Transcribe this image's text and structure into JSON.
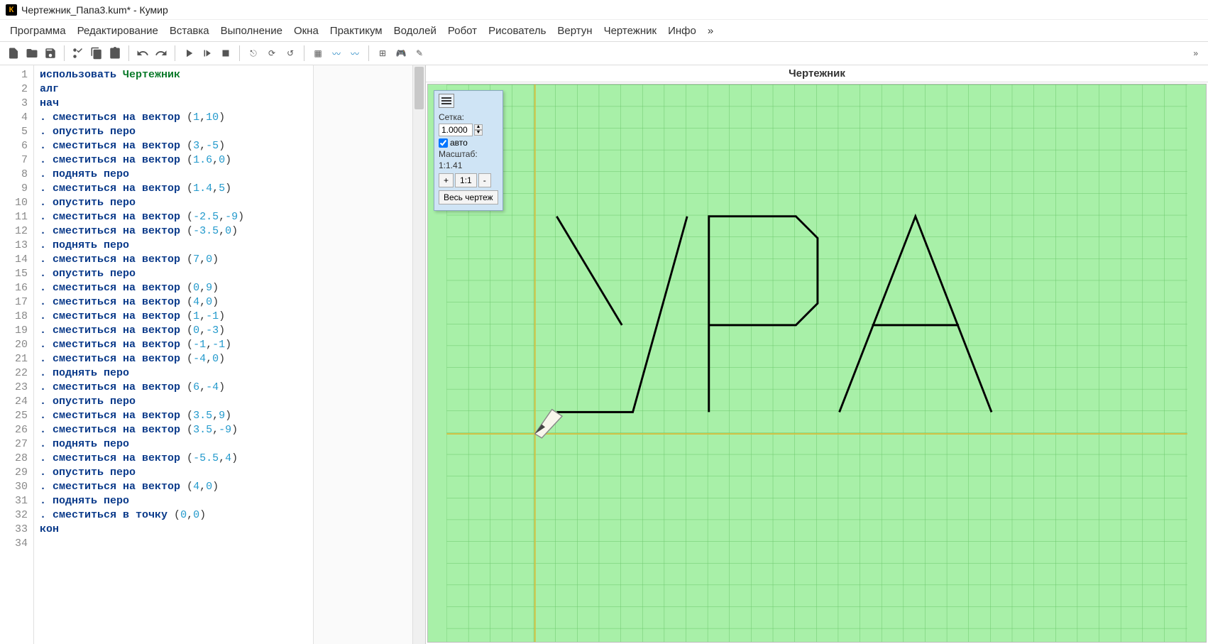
{
  "title": "Чертежник_Папа3.kum* - Кумир",
  "menu": [
    "Программа",
    "Редактирование",
    "Вставка",
    "Выполнение",
    "Окна",
    "Практикум",
    "Водолей",
    "Робот",
    "Рисователь",
    "Вертун",
    "Чертежник",
    "Инфо",
    "»"
  ],
  "panel_title": "Чертежник",
  "panel": {
    "grid_label": "Сетка:",
    "grid_value": "1.0000",
    "auto_label": "авто",
    "auto_checked": true,
    "scale_label": "Масштаб:",
    "scale_value": "1:1.41",
    "zoom_in": "+",
    "zoom_11": "1:1",
    "zoom_out": "-",
    "whole": "Весь чертеж"
  },
  "code": [
    {
      "n": 1,
      "t": "kw-use",
      "tokens": [
        {
          "c": "kw",
          "v": "использовать "
        },
        {
          "c": "kw2",
          "v": "Чертежник"
        }
      ]
    },
    {
      "n": 2,
      "tokens": [
        {
          "c": "kw",
          "v": "алг"
        }
      ]
    },
    {
      "n": 3,
      "tokens": [
        {
          "c": "kw",
          "v": "нач"
        }
      ]
    },
    {
      "n": 4,
      "tokens": [
        {
          "c": "dot",
          "v": ". "
        },
        {
          "c": "cmd",
          "v": "сместиться на вектор "
        },
        {
          "c": "paren",
          "v": "("
        },
        {
          "c": "num",
          "v": "1"
        },
        {
          "c": "paren",
          "v": ","
        },
        {
          "c": "num",
          "v": "10"
        },
        {
          "c": "paren",
          "v": ")"
        }
      ]
    },
    {
      "n": 5,
      "tokens": [
        {
          "c": "dot",
          "v": ". "
        },
        {
          "c": "cmd",
          "v": "опустить перо"
        }
      ]
    },
    {
      "n": 6,
      "tokens": [
        {
          "c": "dot",
          "v": ". "
        },
        {
          "c": "cmd",
          "v": "сместиться на вектор "
        },
        {
          "c": "paren",
          "v": "("
        },
        {
          "c": "num",
          "v": "3"
        },
        {
          "c": "paren",
          "v": ","
        },
        {
          "c": "num",
          "v": "-5"
        },
        {
          "c": "paren",
          "v": ")"
        }
      ]
    },
    {
      "n": 7,
      "tokens": [
        {
          "c": "dot",
          "v": ". "
        },
        {
          "c": "cmd",
          "v": "сместиться на вектор "
        },
        {
          "c": "paren",
          "v": "("
        },
        {
          "c": "num",
          "v": "1.6"
        },
        {
          "c": "paren",
          "v": ","
        },
        {
          "c": "num",
          "v": "0"
        },
        {
          "c": "paren",
          "v": ")"
        }
      ]
    },
    {
      "n": 8,
      "tokens": [
        {
          "c": "dot",
          "v": ". "
        },
        {
          "c": "cmd",
          "v": "поднять перо"
        }
      ]
    },
    {
      "n": 9,
      "tokens": [
        {
          "c": "dot",
          "v": ". "
        },
        {
          "c": "cmd",
          "v": "сместиться на вектор "
        },
        {
          "c": "paren",
          "v": "("
        },
        {
          "c": "num",
          "v": "1.4"
        },
        {
          "c": "paren",
          "v": ","
        },
        {
          "c": "num",
          "v": "5"
        },
        {
          "c": "paren",
          "v": ")"
        }
      ]
    },
    {
      "n": 10,
      "tokens": [
        {
          "c": "dot",
          "v": ". "
        },
        {
          "c": "cmd",
          "v": "опустить перо"
        }
      ]
    },
    {
      "n": 11,
      "tokens": [
        {
          "c": "dot",
          "v": ". "
        },
        {
          "c": "cmd",
          "v": "сместиться на вектор "
        },
        {
          "c": "paren",
          "v": "("
        },
        {
          "c": "num",
          "v": "-2.5"
        },
        {
          "c": "paren",
          "v": ","
        },
        {
          "c": "num",
          "v": "-9"
        },
        {
          "c": "paren",
          "v": ")"
        }
      ]
    },
    {
      "n": 12,
      "tokens": [
        {
          "c": "dot",
          "v": ". "
        },
        {
          "c": "cmd",
          "v": "сместиться на вектор "
        },
        {
          "c": "paren",
          "v": "("
        },
        {
          "c": "num",
          "v": "-3.5"
        },
        {
          "c": "paren",
          "v": ","
        },
        {
          "c": "num",
          "v": "0"
        },
        {
          "c": "paren",
          "v": ")"
        }
      ]
    },
    {
      "n": 13,
      "tokens": [
        {
          "c": "dot",
          "v": ". "
        },
        {
          "c": "cmd",
          "v": "поднять перо"
        }
      ]
    },
    {
      "n": 14,
      "tokens": [
        {
          "c": "dot",
          "v": ". "
        },
        {
          "c": "cmd",
          "v": "сместиться на вектор "
        },
        {
          "c": "paren",
          "v": "("
        },
        {
          "c": "num",
          "v": "7"
        },
        {
          "c": "paren",
          "v": ","
        },
        {
          "c": "num",
          "v": "0"
        },
        {
          "c": "paren",
          "v": ")"
        }
      ]
    },
    {
      "n": 15,
      "tokens": [
        {
          "c": "dot",
          "v": ". "
        },
        {
          "c": "cmd",
          "v": "опустить перо"
        }
      ]
    },
    {
      "n": 16,
      "tokens": [
        {
          "c": "dot",
          "v": ". "
        },
        {
          "c": "cmd",
          "v": "сместиться на вектор "
        },
        {
          "c": "paren",
          "v": "("
        },
        {
          "c": "num",
          "v": "0"
        },
        {
          "c": "paren",
          "v": ","
        },
        {
          "c": "num",
          "v": "9"
        },
        {
          "c": "paren",
          "v": ")"
        }
      ]
    },
    {
      "n": 17,
      "tokens": [
        {
          "c": "dot",
          "v": ". "
        },
        {
          "c": "cmd",
          "v": "сместиться на вектор "
        },
        {
          "c": "paren",
          "v": "("
        },
        {
          "c": "num",
          "v": "4"
        },
        {
          "c": "paren",
          "v": ","
        },
        {
          "c": "num",
          "v": "0"
        },
        {
          "c": "paren",
          "v": ")"
        }
      ]
    },
    {
      "n": 18,
      "tokens": [
        {
          "c": "dot",
          "v": ". "
        },
        {
          "c": "cmd",
          "v": "сместиться на вектор "
        },
        {
          "c": "paren",
          "v": "("
        },
        {
          "c": "num",
          "v": "1"
        },
        {
          "c": "paren",
          "v": ","
        },
        {
          "c": "num",
          "v": "-1"
        },
        {
          "c": "paren",
          "v": ")"
        }
      ]
    },
    {
      "n": 19,
      "tokens": [
        {
          "c": "dot",
          "v": ". "
        },
        {
          "c": "cmd",
          "v": "сместиться на вектор "
        },
        {
          "c": "paren",
          "v": "("
        },
        {
          "c": "num",
          "v": "0"
        },
        {
          "c": "paren",
          "v": ","
        },
        {
          "c": "num",
          "v": "-3"
        },
        {
          "c": "paren",
          "v": ")"
        }
      ]
    },
    {
      "n": 20,
      "tokens": [
        {
          "c": "dot",
          "v": ". "
        },
        {
          "c": "cmd",
          "v": "сместиться на вектор "
        },
        {
          "c": "paren",
          "v": "("
        },
        {
          "c": "num",
          "v": "-1"
        },
        {
          "c": "paren",
          "v": ","
        },
        {
          "c": "num",
          "v": "-1"
        },
        {
          "c": "paren",
          "v": ")"
        }
      ]
    },
    {
      "n": 21,
      "tokens": [
        {
          "c": "dot",
          "v": ". "
        },
        {
          "c": "cmd",
          "v": "сместиться на вектор "
        },
        {
          "c": "paren",
          "v": "("
        },
        {
          "c": "num",
          "v": "-4"
        },
        {
          "c": "paren",
          "v": ","
        },
        {
          "c": "num",
          "v": "0"
        },
        {
          "c": "paren",
          "v": ")"
        }
      ]
    },
    {
      "n": 22,
      "tokens": [
        {
          "c": "dot",
          "v": ". "
        },
        {
          "c": "cmd",
          "v": "поднять перо"
        }
      ]
    },
    {
      "n": 23,
      "tokens": [
        {
          "c": "dot",
          "v": ". "
        },
        {
          "c": "cmd",
          "v": "сместиться на вектор "
        },
        {
          "c": "paren",
          "v": "("
        },
        {
          "c": "num",
          "v": "6"
        },
        {
          "c": "paren",
          "v": ","
        },
        {
          "c": "num",
          "v": "-4"
        },
        {
          "c": "paren",
          "v": ")"
        }
      ]
    },
    {
      "n": 24,
      "tokens": [
        {
          "c": "dot",
          "v": ". "
        },
        {
          "c": "cmd",
          "v": "опустить перо"
        }
      ]
    },
    {
      "n": 25,
      "tokens": [
        {
          "c": "dot",
          "v": ". "
        },
        {
          "c": "cmd",
          "v": "сместиться на вектор "
        },
        {
          "c": "paren",
          "v": "("
        },
        {
          "c": "num",
          "v": "3.5"
        },
        {
          "c": "paren",
          "v": ","
        },
        {
          "c": "num",
          "v": "9"
        },
        {
          "c": "paren",
          "v": ")"
        }
      ]
    },
    {
      "n": 26,
      "tokens": [
        {
          "c": "dot",
          "v": ". "
        },
        {
          "c": "cmd",
          "v": "сместиться на вектор "
        },
        {
          "c": "paren",
          "v": "("
        },
        {
          "c": "num",
          "v": "3.5"
        },
        {
          "c": "paren",
          "v": ","
        },
        {
          "c": "num",
          "v": "-9"
        },
        {
          "c": "paren",
          "v": ")"
        }
      ]
    },
    {
      "n": 27,
      "tokens": [
        {
          "c": "dot",
          "v": ". "
        },
        {
          "c": "cmd",
          "v": "поднять перо"
        }
      ]
    },
    {
      "n": 28,
      "tokens": [
        {
          "c": "dot",
          "v": ". "
        },
        {
          "c": "cmd",
          "v": "сместиться на вектор "
        },
        {
          "c": "paren",
          "v": "("
        },
        {
          "c": "num",
          "v": "-5.5"
        },
        {
          "c": "paren",
          "v": ","
        },
        {
          "c": "num",
          "v": "4"
        },
        {
          "c": "paren",
          "v": ")"
        }
      ]
    },
    {
      "n": 29,
      "tokens": [
        {
          "c": "dot",
          "v": ". "
        },
        {
          "c": "cmd",
          "v": "опустить перо"
        }
      ]
    },
    {
      "n": 30,
      "tokens": [
        {
          "c": "dot",
          "v": ". "
        },
        {
          "c": "cmd",
          "v": "сместиться на вектор "
        },
        {
          "c": "paren",
          "v": "("
        },
        {
          "c": "num",
          "v": "4"
        },
        {
          "c": "paren",
          "v": ","
        },
        {
          "c": "num",
          "v": "0"
        },
        {
          "c": "paren",
          "v": ")"
        }
      ]
    },
    {
      "n": 31,
      "tokens": [
        {
          "c": "dot",
          "v": ". "
        },
        {
          "c": "cmd",
          "v": "поднять перо"
        }
      ]
    },
    {
      "n": 32,
      "tokens": [
        {
          "c": "dot",
          "v": ". "
        },
        {
          "c": "cmd",
          "v": "сместиться в точку "
        },
        {
          "c": "paren",
          "v": "("
        },
        {
          "c": "num",
          "v": "0"
        },
        {
          "c": "paren",
          "v": ","
        },
        {
          "c": "num",
          "v": "0"
        },
        {
          "c": "paren",
          "v": ")"
        }
      ]
    },
    {
      "n": 33,
      "tokens": [
        {
          "c": "kw",
          "v": "кон"
        }
      ]
    },
    {
      "n": 34,
      "tokens": []
    }
  ]
}
